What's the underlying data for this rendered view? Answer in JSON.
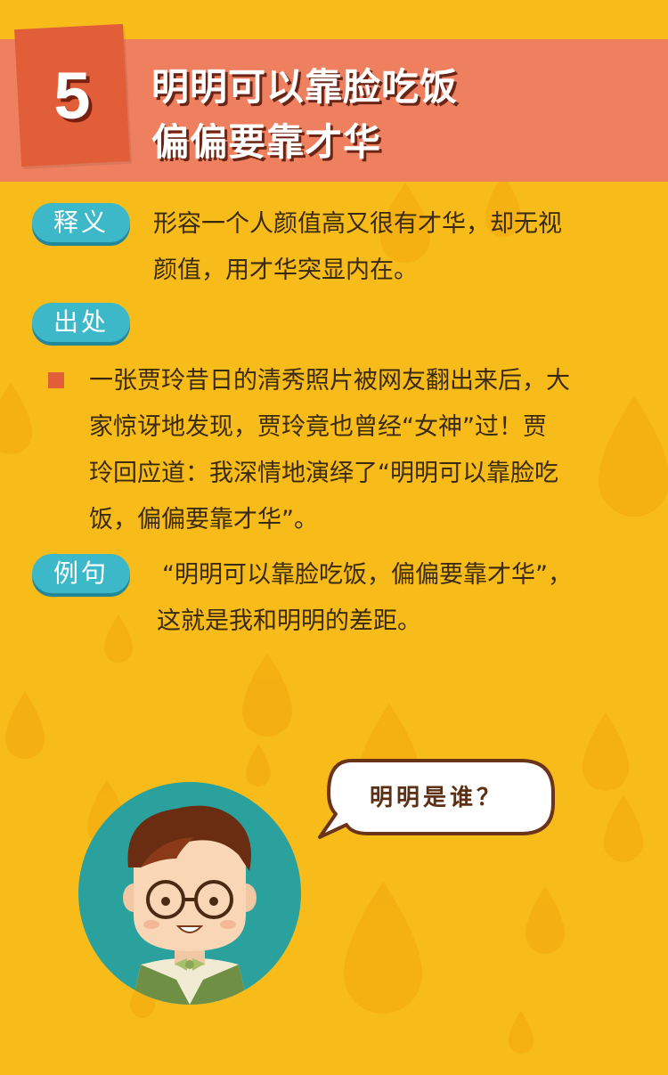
{
  "header": {
    "number": "5",
    "title_line1": "明明可以靠脸吃饭",
    "title_line2": "偏偏要靠才华"
  },
  "sections": {
    "meaning": {
      "label": "释义",
      "text_line1": "形容一个人颜值高又很有才华，却无视",
      "text_line2": "颜值，用才华突显内在。"
    },
    "origin": {
      "label": "出处",
      "text_line1": "一张贾玲昔日的清秀照片被网友翻出来后，大",
      "text_line2": "家惊讶地发现，贾玲竟也曾经“女神”过！贾",
      "text_line3": "玲回应道：我深情地演绎了“明明可以靠脸吃",
      "text_line4": "饭，偏偏要靠才华”。"
    },
    "example": {
      "label": "例句",
      "text_line1": "“明明可以靠脸吃饭，偏偏要靠才华”，",
      "text_line2": "这就是我和明明的差距。"
    }
  },
  "speech_bubble": {
    "text": "明明是谁？"
  },
  "colors": {
    "background": "#F8BC1A",
    "header_band": "#EE8060",
    "badge": "#E25E39",
    "pill": "#3DB8C8",
    "avatar_bg": "#2AA19C"
  }
}
